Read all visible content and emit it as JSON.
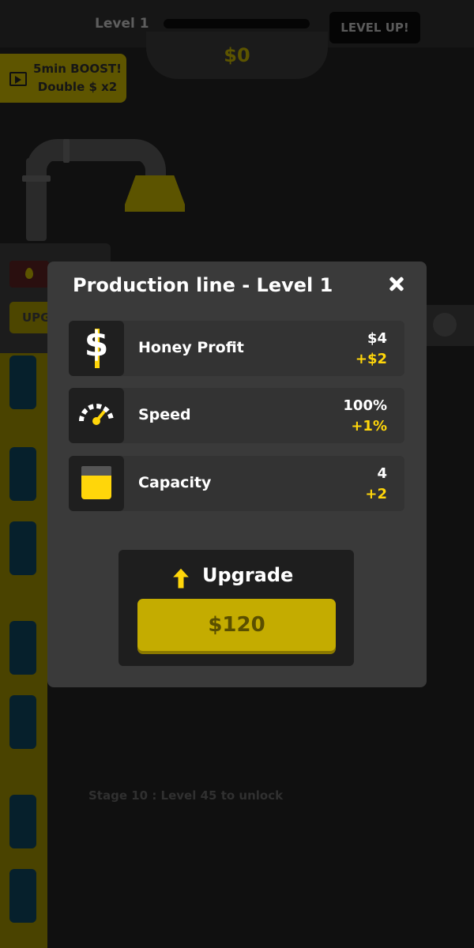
{
  "hud": {
    "level_label": "Level 1",
    "levelup_label": "LEVEL UP!",
    "money": "$0",
    "xp_progress": 0
  },
  "boost": {
    "line1": "5min BOOST!",
    "line2": "Double $ x2"
  },
  "machine": {
    "upgrade_chip_label": "UPG"
  },
  "stage_lock_text": "Stage 10 : Level 45 to unlock",
  "modal": {
    "title": "Production line - Level 1",
    "stats": [
      {
        "label": "Honey Profit",
        "value": "$4",
        "bonus": "+$2",
        "icon": "dollar-icon"
      },
      {
        "label": "Speed",
        "value": "100%",
        "bonus": "+1%",
        "icon": "speedometer-icon"
      },
      {
        "label": "Capacity",
        "value": "4",
        "bonus": "+2",
        "icon": "honey-jar-icon"
      }
    ],
    "upgrade_label": "Upgrade",
    "upgrade_price": "$120",
    "close_icon": "close-icon"
  },
  "colors": {
    "accent_yellow": "#ffd60a",
    "modal_bg": "#3a3a3a",
    "button_yellow": "#c4ac00"
  }
}
